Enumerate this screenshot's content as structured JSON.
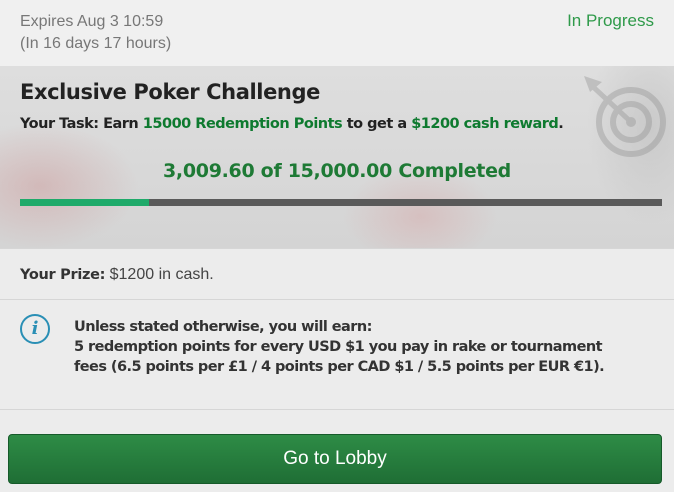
{
  "header": {
    "expires": "Expires Aug 3 10:59",
    "remaining": "(In 16 days 17 hours)",
    "status": "In Progress"
  },
  "challenge": {
    "title": "Exclusive Poker Challenge",
    "task_prefix": "Your Task: Earn ",
    "task_points": "15000 Redemption Points",
    "task_middle": " to get a ",
    "task_reward": "$1200 cash reward",
    "task_suffix": ".",
    "progress_text": "3,009.60 of 15,000.00 Completed",
    "progress_fraction": 0.2006,
    "decoration_icon": "target-icon"
  },
  "prize": {
    "label": "Your Prize:",
    "value": " $1200 in cash."
  },
  "info": {
    "icon": "info-icon",
    "line1": "Unless stated otherwise, you will earn:",
    "line2": "5 redemption points for every USD $1 you pay in rake or tournament",
    "line3": "fees (6.5 points per £1 / 4 points per CAD $1 / 5.5 points per EUR €1)."
  },
  "actions": {
    "lobby_label": "Go to Lobby"
  },
  "colors": {
    "accent_green": "#1faa6a",
    "status_green": "#2f9a4a",
    "button_green": "#2e8c46",
    "info_blue": "#2a8fb5"
  }
}
